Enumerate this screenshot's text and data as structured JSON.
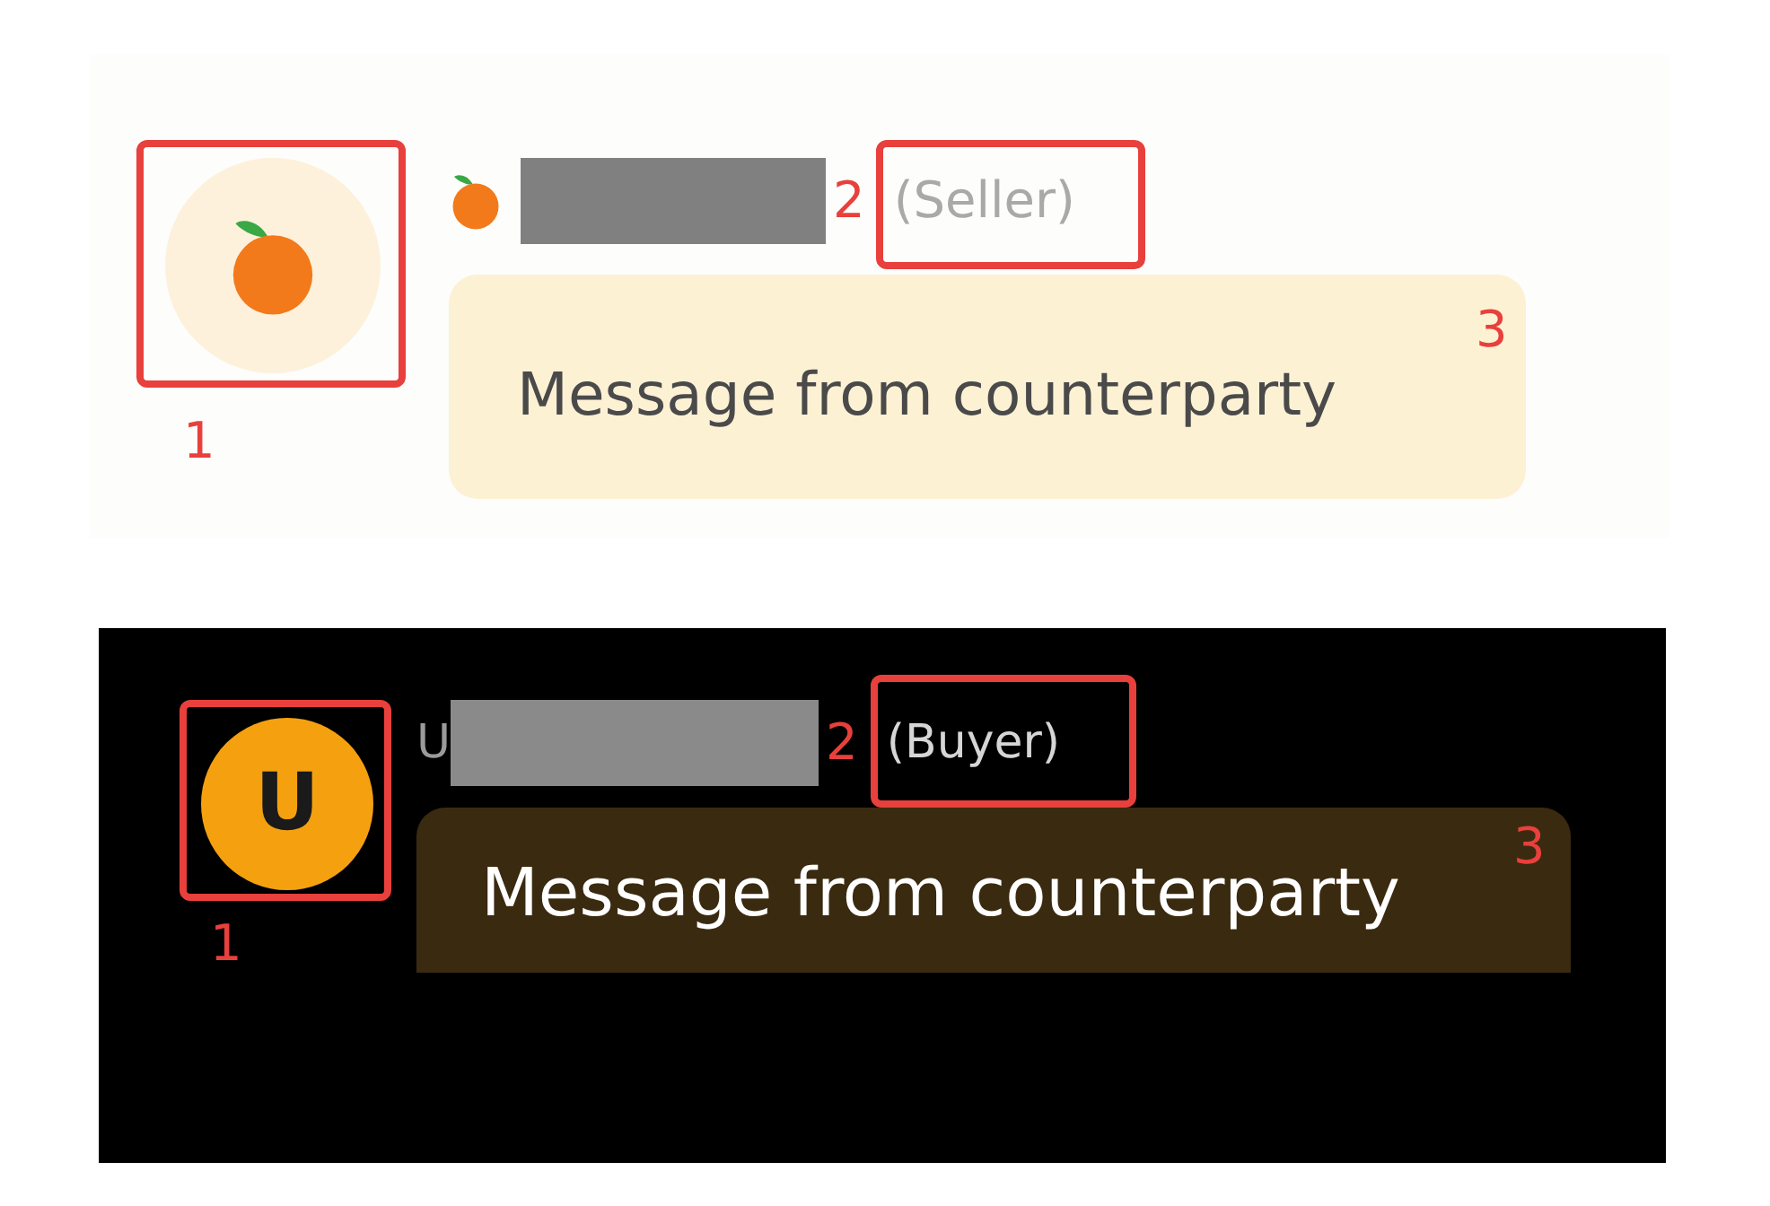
{
  "panels": [
    {
      "kind": "light",
      "avatar": {
        "kind": "fruit"
      },
      "name_prefix": {
        "kind": "icon"
      },
      "role": "(Seller)",
      "message": "Message from counterparty",
      "markers": [
        "1",
        "2",
        "3"
      ]
    },
    {
      "kind": "dark",
      "avatar": {
        "kind": "letter",
        "letter": "U"
      },
      "name_prefix": {
        "kind": "text",
        "text": "U"
      },
      "role": "(Buyer)",
      "message": "Message from counterparty",
      "markers": [
        "1",
        "2",
        "3"
      ]
    }
  ]
}
